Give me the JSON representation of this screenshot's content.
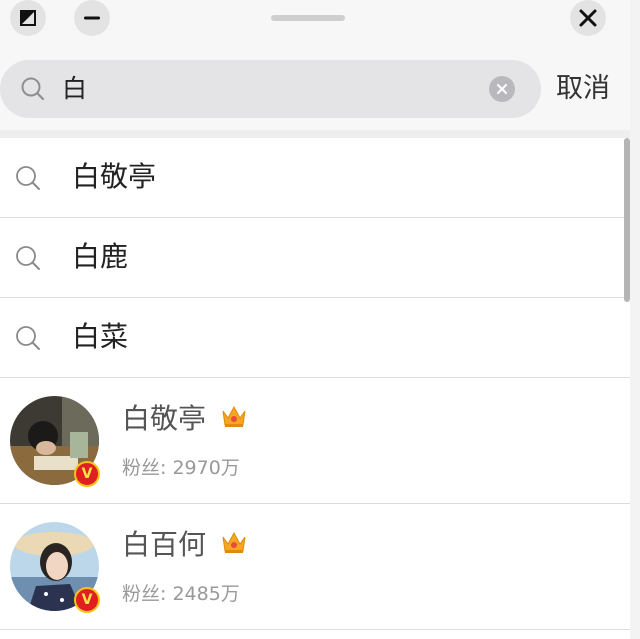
{
  "window": {
    "resize_icon": "resize-icon",
    "minimize_icon": "minimize-icon",
    "close_icon": "close-icon"
  },
  "search": {
    "query": "白",
    "icon": "search-icon",
    "clear_icon": "clear-icon",
    "cancel_label": "取消"
  },
  "suggestions": [
    {
      "text": "白敬亭",
      "icon": "search-icon"
    },
    {
      "text": "白鹿",
      "icon": "search-icon"
    },
    {
      "text": "白菜",
      "icon": "search-icon"
    }
  ],
  "users": [
    {
      "name": "白敬亭",
      "fans": "粉丝: 2970万",
      "verified_mark": "V",
      "badge_icon": "crown-icon"
    },
    {
      "name": "白百何",
      "fans": "粉丝: 2485万",
      "verified_mark": "V",
      "badge_icon": "crown-icon"
    }
  ],
  "colors": {
    "accent_red": "#e02020",
    "crown_gold": "#f5a623",
    "text_secondary": "#999999"
  }
}
